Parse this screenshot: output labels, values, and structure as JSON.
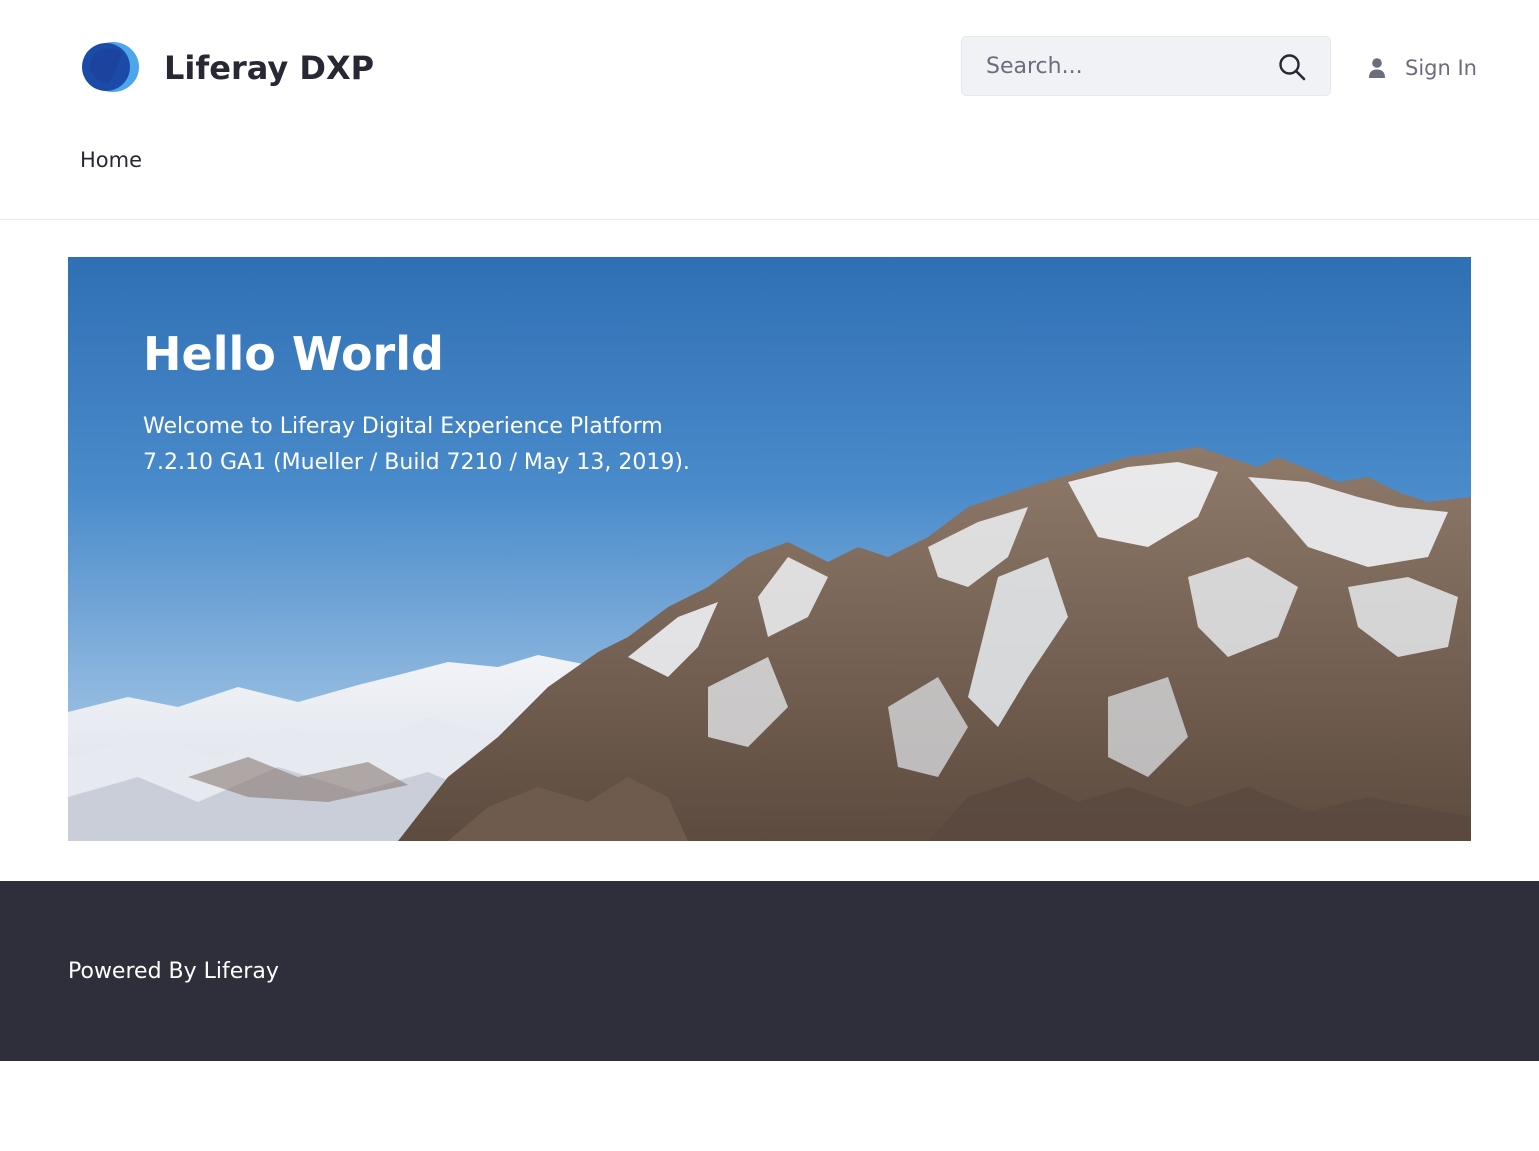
{
  "header": {
    "brand_name": "Liferay DXP",
    "logo_icon": "liferay-logo-icon",
    "search": {
      "placeholder": "Search...",
      "value": "",
      "icon": "search-icon"
    },
    "sign_in_label": "Sign In",
    "sign_in_icon": "user-icon"
  },
  "nav": {
    "items": [
      {
        "label": "Home"
      }
    ]
  },
  "hero": {
    "title": "Hello World",
    "text": "Welcome to Liferay Digital Experience Platform 7.2.10 GA1 (Mueller / Build 7210 / May 13, 2019).",
    "image": "mountain-landscape-image"
  },
  "footer": {
    "prefix": "Powered By ",
    "link_label": "Liferay"
  },
  "colors": {
    "text": "#272833",
    "muted": "#6b6c7e",
    "footer_bg": "#2e2f3b",
    "search_bg": "#f1f2f5",
    "logo_light": "#4ea6ea",
    "logo_dark": "#1b4ba8"
  }
}
